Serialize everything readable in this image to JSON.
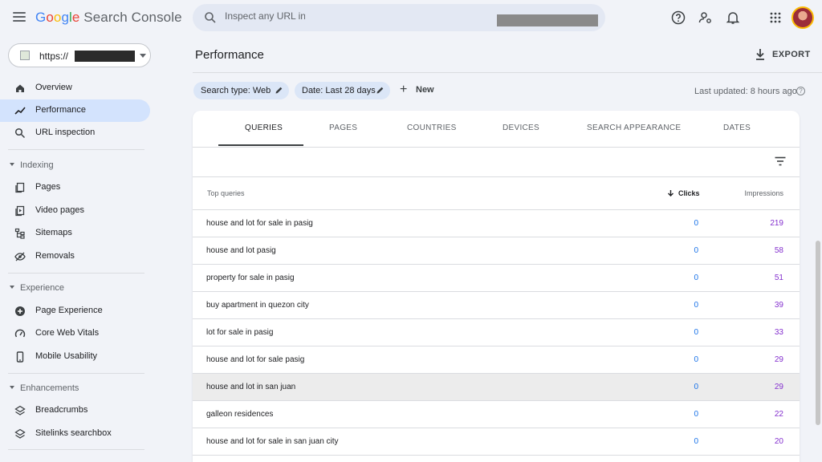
{
  "app": {
    "logo_google": [
      "G",
      "o",
      "o",
      "g",
      "l",
      "e"
    ],
    "logo_product": "Search Console"
  },
  "search": {
    "placeholder": "Inspect any URL in"
  },
  "property": {
    "prefix": "https://"
  },
  "sidebar": {
    "items": [
      {
        "label": "Overview",
        "icon": "home-icon"
      },
      {
        "label": "Performance",
        "icon": "trending-icon",
        "active": true
      },
      {
        "label": "URL inspection",
        "icon": "search-icon"
      }
    ],
    "sections": [
      {
        "title": "Indexing",
        "items": [
          {
            "label": "Pages",
            "icon": "pages-icon"
          },
          {
            "label": "Video pages",
            "icon": "video-pages-icon"
          },
          {
            "label": "Sitemaps",
            "icon": "sitemap-icon"
          },
          {
            "label": "Removals",
            "icon": "eye-off-icon"
          }
        ]
      },
      {
        "title": "Experience",
        "items": [
          {
            "label": "Page Experience",
            "icon": "plus-circle-icon"
          },
          {
            "label": "Core Web Vitals",
            "icon": "gauge-icon"
          },
          {
            "label": "Mobile Usability",
            "icon": "phone-icon"
          }
        ]
      },
      {
        "title": "Enhancements",
        "items": [
          {
            "label": "Breadcrumbs",
            "icon": "layers-icon"
          },
          {
            "label": "Sitelinks searchbox",
            "icon": "layers-icon"
          }
        ]
      }
    ]
  },
  "main": {
    "title": "Performance",
    "export_label": "EXPORT",
    "filters": {
      "search_type": "Search type: Web",
      "date": "Date: Last 28 days",
      "new_label": "New"
    },
    "last_updated": "Last updated: 8 hours ago",
    "tabs": [
      {
        "label": "QUERIES",
        "active": true
      },
      {
        "label": "PAGES"
      },
      {
        "label": "COUNTRIES"
      },
      {
        "label": "DEVICES"
      },
      {
        "label": "SEARCH APPEARANCE"
      },
      {
        "label": "DATES"
      }
    ],
    "table": {
      "headers": {
        "query": "Top queries",
        "clicks": "Clicks",
        "impressions": "Impressions"
      },
      "rows": [
        {
          "query": "house and lot for sale in pasig",
          "clicks": "0",
          "impressions": "219"
        },
        {
          "query": "house and lot pasig",
          "clicks": "0",
          "impressions": "58"
        },
        {
          "query": "property for sale in pasig",
          "clicks": "0",
          "impressions": "51"
        },
        {
          "query": "buy apartment in quezon city",
          "clicks": "0",
          "impressions": "39"
        },
        {
          "query": "lot for sale in pasig",
          "clicks": "0",
          "impressions": "33"
        },
        {
          "query": "house and lot for sale pasig",
          "clicks": "0",
          "impressions": "29"
        },
        {
          "query": "house and lot in san juan",
          "clicks": "0",
          "impressions": "29",
          "highlighted": true
        },
        {
          "query": "galleon residences",
          "clicks": "0",
          "impressions": "22"
        },
        {
          "query": "house and lot for sale in san juan city",
          "clicks": "0",
          "impressions": "20"
        }
      ]
    }
  },
  "colors": {
    "background": "#f1f3f8",
    "active_nav": "#d3e3fd",
    "clicks": "#1a73e8",
    "impressions": "#8430ce"
  }
}
